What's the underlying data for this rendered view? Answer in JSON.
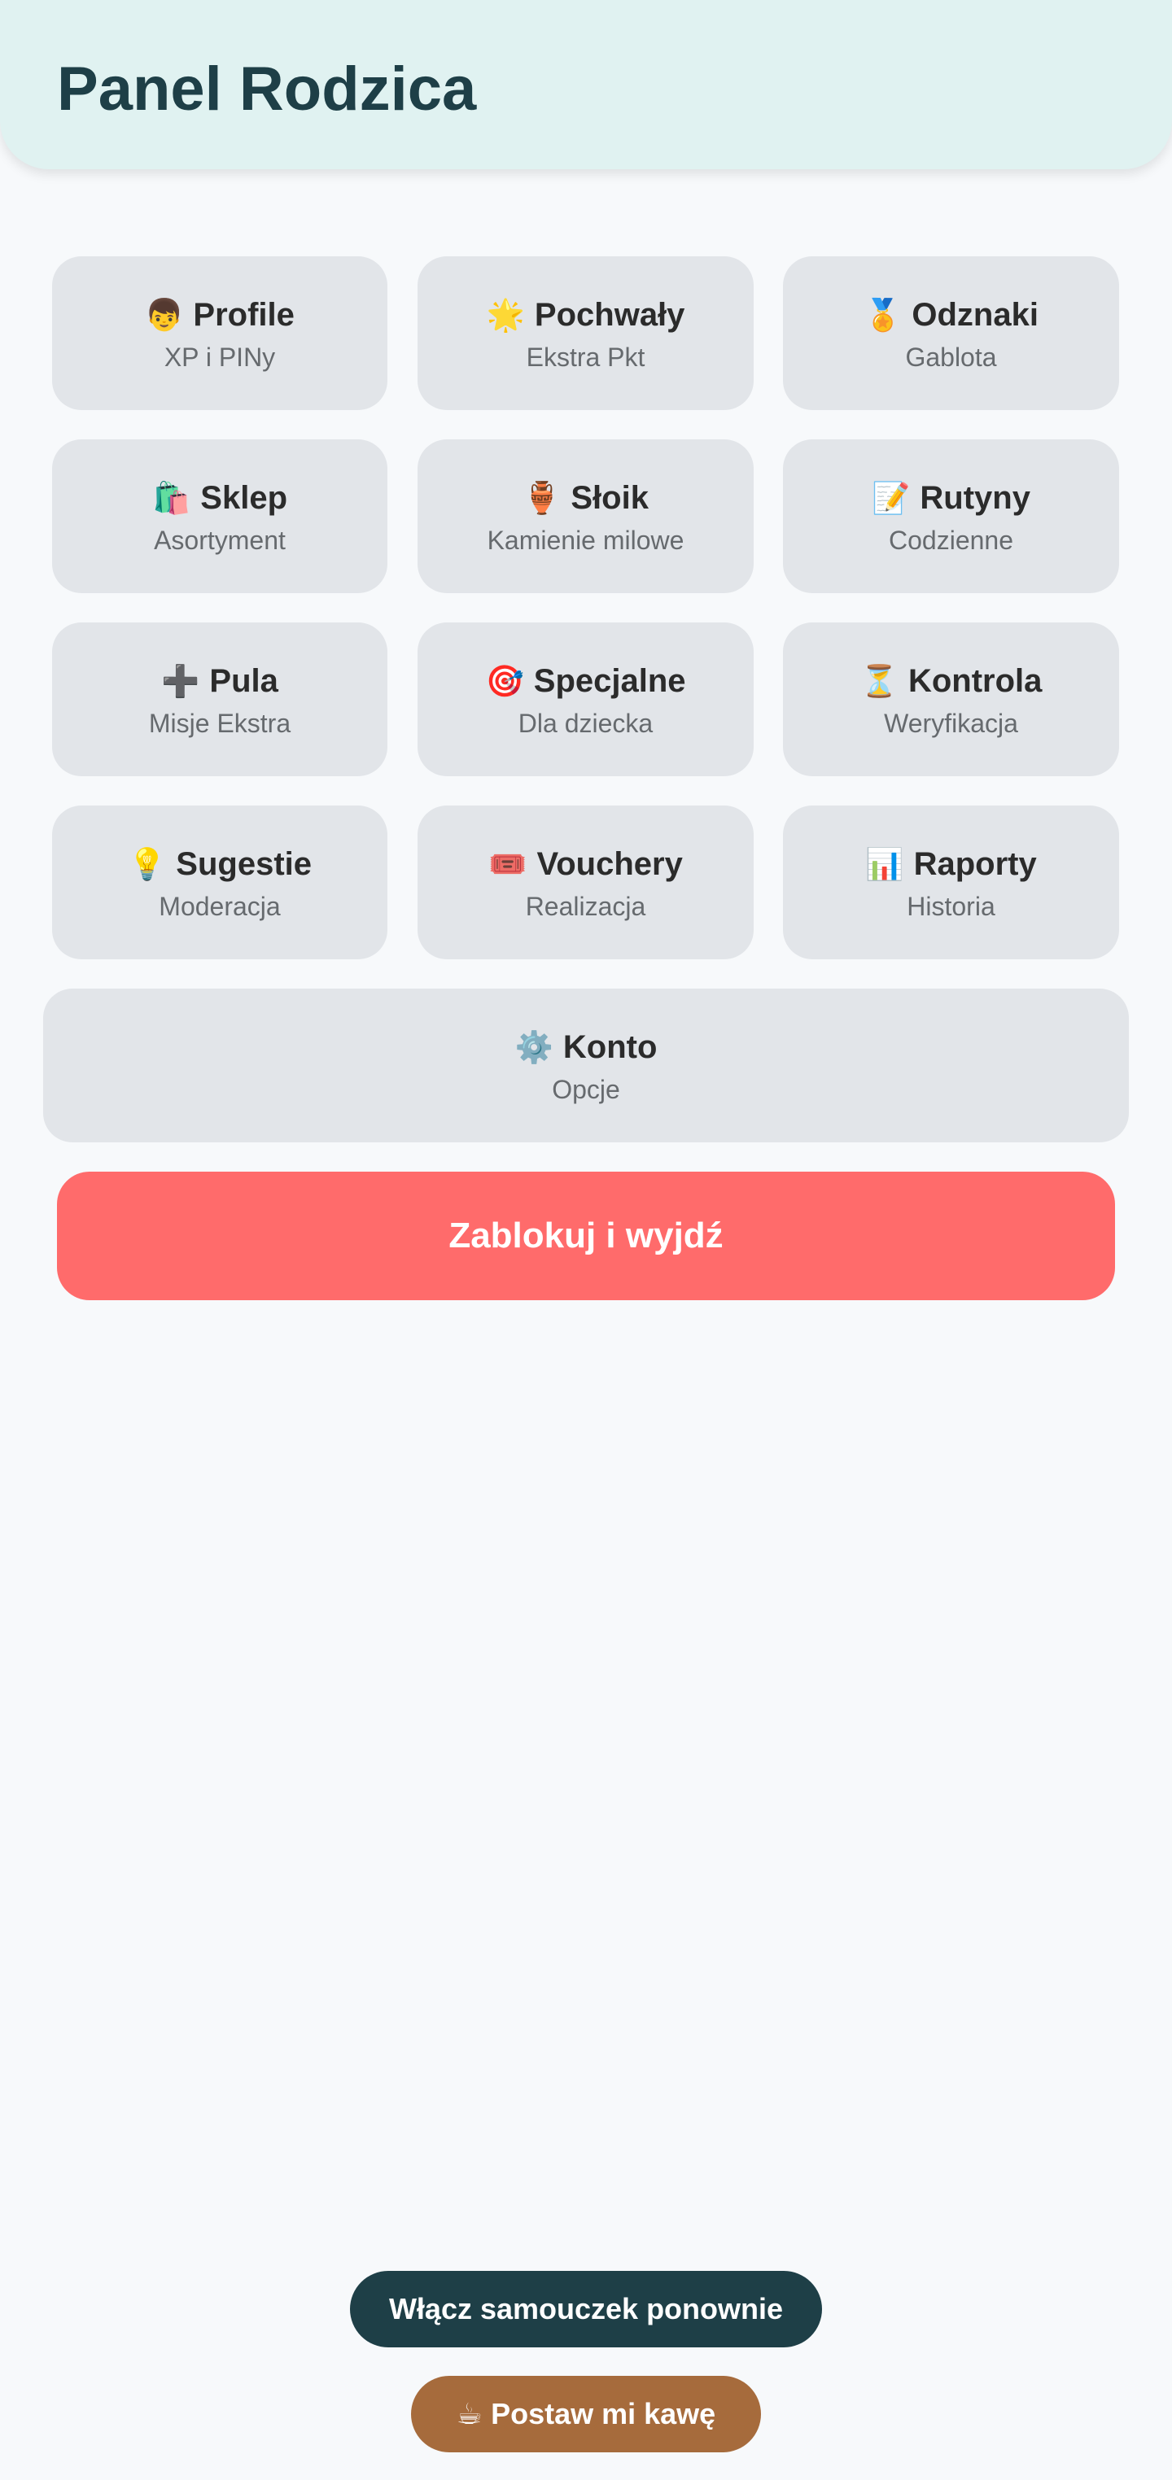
{
  "header": {
    "title": "Panel Rodzica"
  },
  "tiles": [
    {
      "icon": "👦",
      "icon_name": "boy-icon",
      "title": "Profile",
      "subtitle": "XP i PINy"
    },
    {
      "icon": "🌟",
      "icon_name": "star-icon",
      "title": "Pochwały",
      "subtitle": "Ekstra Pkt"
    },
    {
      "icon": "🏅",
      "icon_name": "medal-icon",
      "title": "Odznaki",
      "subtitle": "Gablota"
    },
    {
      "icon": "🛍️",
      "icon_name": "shopping-bags-icon",
      "title": "Sklep",
      "subtitle": "Asortyment"
    },
    {
      "icon": "🏺",
      "icon_name": "jar-icon",
      "title": "Słoik",
      "subtitle": "Kamienie milowe"
    },
    {
      "icon": "📝",
      "icon_name": "memo-icon",
      "title": "Rutyny",
      "subtitle": "Codzienne"
    },
    {
      "icon": "➕",
      "icon_name": "plus-icon",
      "title": "Pula",
      "subtitle": "Misje Ekstra"
    },
    {
      "icon": "🎯",
      "icon_name": "target-icon",
      "title": "Specjalne",
      "subtitle": "Dla dziecka"
    },
    {
      "icon": "⏳",
      "icon_name": "hourglass-icon",
      "title": "Kontrola",
      "subtitle": "Weryfikacja"
    },
    {
      "icon": "💡",
      "icon_name": "lightbulb-icon",
      "title": "Sugestie",
      "subtitle": "Moderacja"
    },
    {
      "icon": "🎟️",
      "icon_name": "ticket-icon",
      "title": "Vouchery",
      "subtitle": "Realizacja"
    },
    {
      "icon": "📊",
      "icon_name": "bar-chart-icon",
      "title": "Raporty",
      "subtitle": "Historia"
    },
    {
      "icon": "⚙️",
      "icon_name": "gear-icon",
      "title": "Konto",
      "subtitle": "Opcje"
    }
  ],
  "actions": {
    "lock_label": "Zablokuj i wyjdź",
    "tutorial_label": "Włącz samouczek ponownie",
    "coffee_icon": "☕",
    "coffee_label": "Postaw mi kawę"
  },
  "colors": {
    "header_bg": "#e0f2f1",
    "title": "#1e3f47",
    "tile_bg": "#e2e5e9",
    "lock_button": "#ff6b6b",
    "tutorial_button": "#1e3f47",
    "coffee_button": "#a66b3c"
  }
}
